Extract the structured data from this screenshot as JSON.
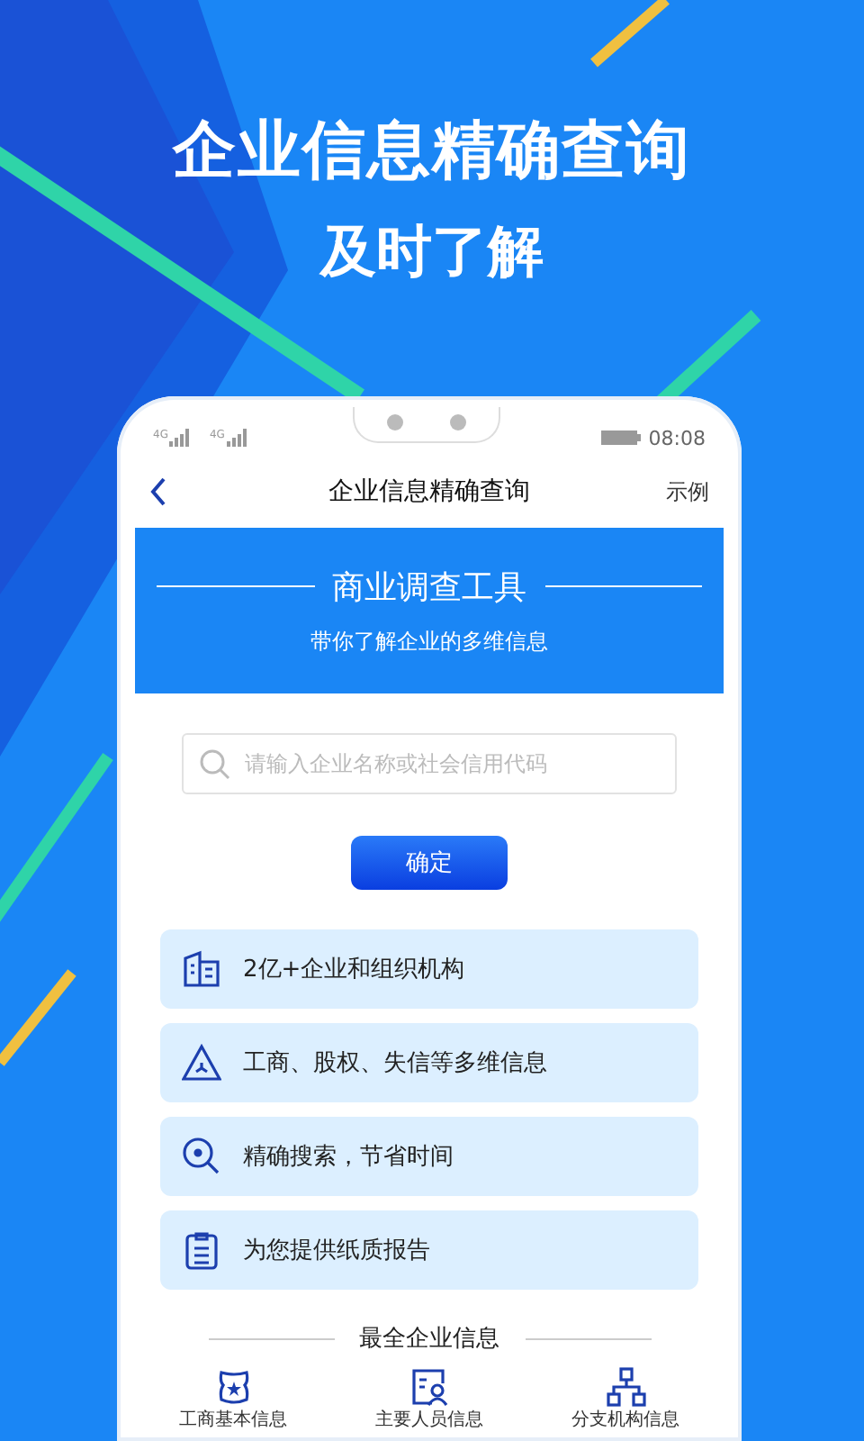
{
  "headline": "企业信息精确查询",
  "subheadline": "及时了解",
  "status_bar": {
    "networks": [
      "4G",
      "4G"
    ],
    "time": "08:08"
  },
  "nav": {
    "title": "企业信息精确查询",
    "action": "示例"
  },
  "banner": {
    "title": "商业调查工具",
    "subtitle": "带你了解企业的多维信息"
  },
  "search": {
    "placeholder": "请输入企业名称或社会信用代码"
  },
  "confirm_button": "确定",
  "features": [
    {
      "kind": "building",
      "text": "2亿+企业和组织机构"
    },
    {
      "kind": "triangle",
      "text": "工商、股权、失信等多维信息"
    },
    {
      "kind": "search",
      "text": "精确搜索，节省时间"
    },
    {
      "kind": "clipboard",
      "text": "为您提供纸质报告"
    }
  ],
  "section_title": "最全企业信息",
  "categories": [
    {
      "kind": "badge",
      "label": "工商基本信息"
    },
    {
      "kind": "person",
      "label": "主要人员信息"
    },
    {
      "kind": "branch",
      "label": "分支机构信息"
    }
  ]
}
